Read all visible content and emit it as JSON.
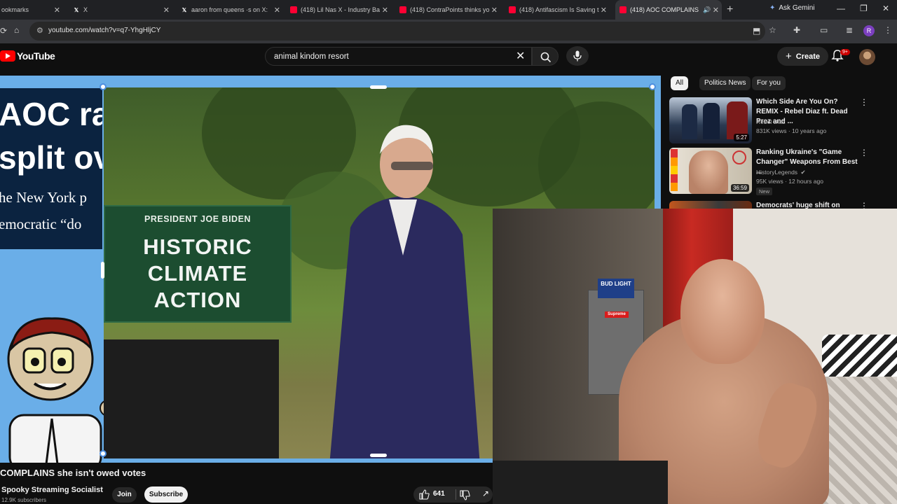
{
  "browser": {
    "tabs": [
      {
        "label": "ookmarks",
        "icon": "none"
      },
      {
        "label": "X",
        "icon": "x-icon"
      },
      {
        "label": "aaron from queens ·s on X:",
        "icon": "x-icon"
      },
      {
        "label": "(418) Lil Nas X - Industry Ba",
        "icon": "youtube-icon"
      },
      {
        "label": "(418) ContraPoints thinks yo",
        "icon": "youtube-icon"
      },
      {
        "label": "(418) Antifascism Is Saving t",
        "icon": "youtube-icon"
      },
      {
        "label": "(418) AOC COMPLAINS",
        "icon": "youtube-icon"
      }
    ],
    "gemini_label": "Ask Gemini",
    "url": "youtube.com/watch?v=q7-YhgHljCY"
  },
  "youtube": {
    "logo_text": "YouTube",
    "search_value": "animal kindom resort",
    "create_label": "Create",
    "notification_count": "9+",
    "chips": [
      "All",
      "Politics News",
      "For you"
    ],
    "recommendations": [
      {
        "title": "Which Side Are You On? REMIX - Rebel Diaz ft. Dead Prez and ...",
        "channel": "Rebel Diaz",
        "meta": "831K views · 10 years ago",
        "duration": "5:27"
      },
      {
        "title": "Ranking Ukraine's \"Game Changer\" Weapons From Best ...",
        "channel": "HistoryLegends",
        "meta": "95K views · 12 hours ago",
        "duration": "36:59",
        "badge": "New"
      },
      {
        "title": "Democrats' huge shift on Israel,",
        "channel": "",
        "meta": "",
        "duration": ""
      }
    ]
  },
  "video": {
    "overlay_left": {
      "line1": "AOC ral",
      "line2": "split ove",
      "line3": "he New York p",
      "line4": "emocratic “do"
    },
    "sign": {
      "subtitle": "PRESIDENT JOE BIDEN",
      "line1": "HISTORIC",
      "line2": "CLIMATE",
      "line3": "ACTION"
    },
    "webcam": {
      "bud_light": "BUD LIGHT",
      "supreme": "Supreme"
    },
    "title": "COMPLAINS she isn't owed votes",
    "channel": "Spooky Streaming Socialist",
    "subscribers": "12.9K subscribers",
    "join_label": "Join",
    "subscribe_label": "Subscribe",
    "like_count": "641"
  },
  "colors": {
    "youtube_red": "#ff0000",
    "player_blue": "#6aaee8",
    "page_bg": "#0f0f0f"
  }
}
